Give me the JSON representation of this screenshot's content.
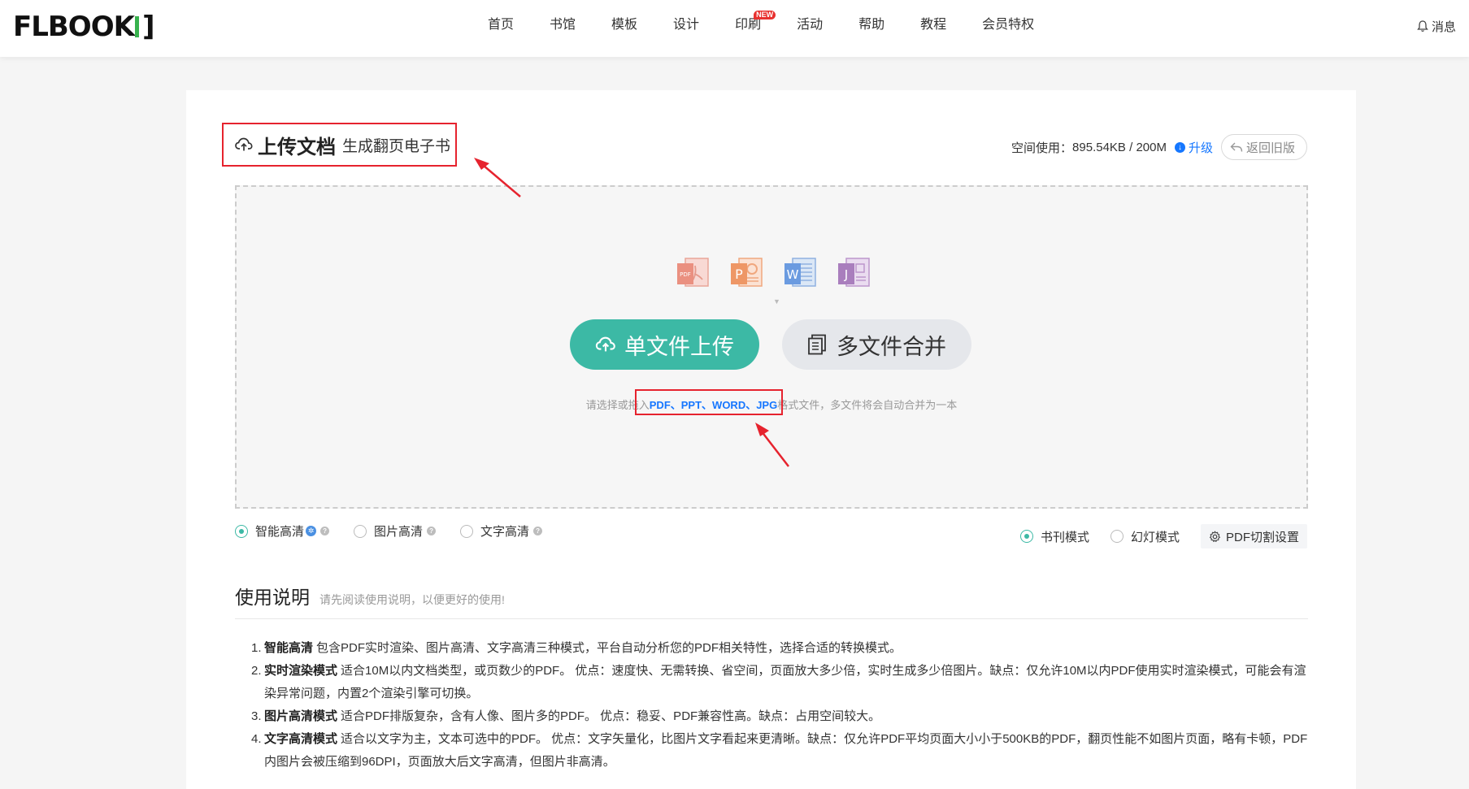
{
  "header": {
    "logo": "FLBOOK",
    "nav": [
      {
        "label": "首页"
      },
      {
        "label": "书馆"
      },
      {
        "label": "模板"
      },
      {
        "label": "设计"
      },
      {
        "label": "印刷",
        "badge": "NEW"
      },
      {
        "label": "活动"
      },
      {
        "label": "帮助"
      },
      {
        "label": "教程"
      },
      {
        "label": "会员特权"
      }
    ],
    "message": "消息"
  },
  "upload": {
    "title": "上传文档",
    "subtitle": "生成翻页电子书",
    "space_label": "空间使用：",
    "space_value": "895.54KB / 200M",
    "upgrade": "升级",
    "old_version": "返回旧版",
    "file_icons": [
      "pdf-file-icon",
      "ppt-file-icon",
      "word-file-icon",
      "jpg-file-icon"
    ],
    "single_upload": "单文件上传",
    "multi_merge": "多文件合并",
    "hint_prefix": "请选择或拖入",
    "hint_formats": "PDF、PPT、WORD、JPG",
    "hint_suffix": "格式文件，多文件将会自动合并为一本"
  },
  "options": {
    "quality": [
      {
        "label": "智能高清",
        "selected": true
      },
      {
        "label": "图片高清",
        "selected": false
      },
      {
        "label": "文字高清",
        "selected": false
      }
    ],
    "mode": [
      {
        "label": "书刊模式",
        "selected": true
      },
      {
        "label": "幻灯模式",
        "selected": false
      }
    ],
    "pdf_settings": "PDF切割设置"
  },
  "instructions": {
    "title": "使用说明",
    "subtitle": "请先阅读使用说明，以便更好的使用!",
    "items": [
      {
        "num": "1.",
        "head": "智能高清",
        "text": "包含PDF实时渲染、图片高清、文字高清三种模式，平台自动分析您的PDF相关特性，选择合适的转换模式。"
      },
      {
        "num": "2.",
        "head": "实时渲染模式",
        "text": "适合10M以内文档类型，或页数少的PDF。 优点：速度快、无需转换、省空间，页面放大多少倍，实时生成多少倍图片。缺点：仅允许10M以内PDF使用实时渲染模式，可能会有渲染异常问题，内置2个渲染引擎可切换。"
      },
      {
        "num": "3.",
        "head": "图片高清模式",
        "text": "适合PDF排版复杂，含有人像、图片多的PDF。 优点：稳妥、PDF兼容性高。缺点：占用空间较大。"
      },
      {
        "num": "4.",
        "head": "文字高清模式",
        "text": "适合以文字为主，文本可选中的PDF。 优点：文字矢量化，比图片文字看起来更清晰。缺点：仅允许PDF平均页面大小小于500KB的PDF，翻页性能不如图片页面，略有卡顿，PDF内图片会被压缩到96DPI，页面放大后文字高清，但图片非高清。"
      }
    ]
  },
  "colors": {
    "accent": "#3cb9a5",
    "link": "#1677ff",
    "annotation": "#e6232e"
  }
}
